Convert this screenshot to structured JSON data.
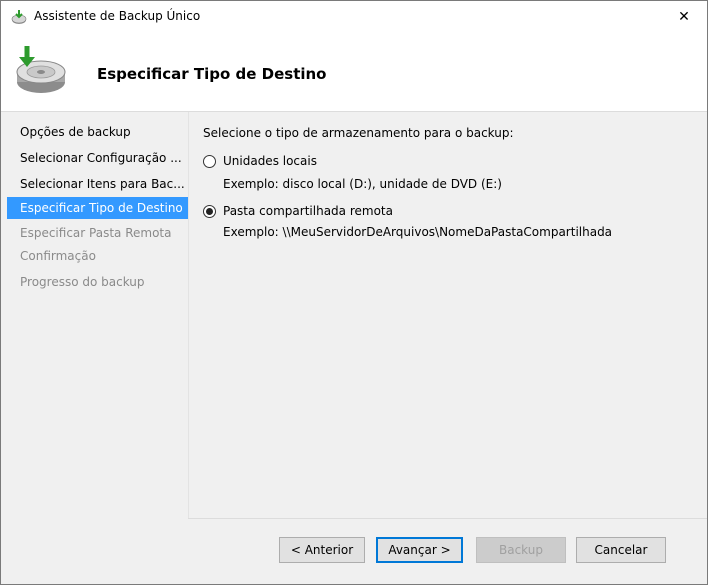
{
  "window": {
    "title": "Assistente de Backup Único",
    "close_glyph": "✕"
  },
  "header": {
    "title": "Especificar Tipo de Destino"
  },
  "nav": {
    "items": [
      {
        "label": "Opções de backup",
        "state": "done"
      },
      {
        "label": "Selecionar Configuração ...",
        "state": "done"
      },
      {
        "label": "Selecionar Itens para Bac...",
        "state": "done"
      },
      {
        "label": "Especificar Tipo de Destino",
        "state": "selected"
      },
      {
        "label": "Especificar Pasta Remota",
        "state": "disabled"
      },
      {
        "label": "Confirmação",
        "state": "disabled"
      },
      {
        "label": "Progresso do backup",
        "state": "disabled"
      }
    ]
  },
  "main": {
    "prompt": "Selecione o tipo de armazenamento para o backup:",
    "options": [
      {
        "label": "Unidades locais",
        "example": "Exemplo: disco local (D:), unidade de DVD (E:)",
        "checked": false
      },
      {
        "label": "Pasta compartilhada remota",
        "example": "Exemplo: \\\\MeuServidorDeArquivos\\NomeDaPastaCompartilhada",
        "checked": true
      }
    ]
  },
  "buttons": {
    "previous": "< Anterior",
    "next": "Avançar >",
    "backup": "Backup",
    "cancel": "Cancelar"
  },
  "colors": {
    "selection": "#3399ff",
    "default_button_border": "#0078d7"
  },
  "icons": {
    "title": "backup-icon",
    "header": "backup-drive-icon",
    "close": "close-icon"
  }
}
